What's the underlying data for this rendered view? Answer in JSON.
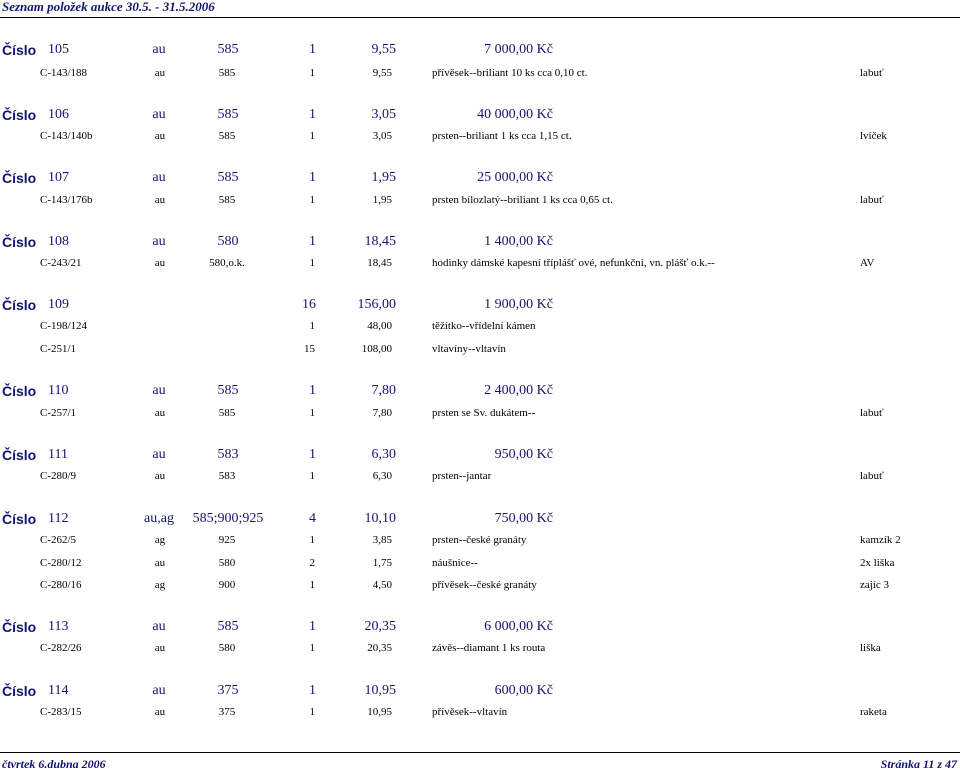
{
  "document": {
    "title": "Seznam položek aukce 30.5. - 31.5.2006",
    "number_label": "Číslo"
  },
  "items": [
    {
      "number": "105",
      "metal": "au",
      "fineness": "585",
      "count": "1",
      "weight": "9,55",
      "price": "7 000,00 Kč",
      "pieces": [
        {
          "code": "C-143/188",
          "metal": "au",
          "fineness": "585",
          "count": "1",
          "weight": "9,55",
          "description": "přívěsek--briliant 10 ks cca 0,10 ct.",
          "mark": "labuť"
        }
      ]
    },
    {
      "number": "106",
      "metal": "au",
      "fineness": "585",
      "count": "1",
      "weight": "3,05",
      "price": "40 000,00 Kč",
      "pieces": [
        {
          "code": "C-143/140b",
          "metal": "au",
          "fineness": "585",
          "count": "1",
          "weight": "3,05",
          "description": "prsten--briliant 1 ks cca 1,15 ct.",
          "mark": "lvíček"
        }
      ]
    },
    {
      "number": "107",
      "metal": "au",
      "fineness": "585",
      "count": "1",
      "weight": "1,95",
      "price": "25 000,00 Kč",
      "pieces": [
        {
          "code": "C-143/176b",
          "metal": "au",
          "fineness": "585",
          "count": "1",
          "weight": "1,95",
          "description": "prsten bílozlatý--briliant 1 ks cca 0,65 ct.",
          "mark": "labuť"
        }
      ]
    },
    {
      "number": "108",
      "metal": "au",
      "fineness": "580",
      "count": "1",
      "weight": "18,45",
      "price": "1 400,00 Kč",
      "pieces": [
        {
          "code": "C-243/21",
          "metal": "au",
          "fineness": "580,o.k.",
          "count": "1",
          "weight": "18,45",
          "description": "hodinky dámské kapesní tříplášť ové, nefunkční, vn. plášť o.k.--",
          "mark": "AV"
        }
      ]
    },
    {
      "number": "109",
      "count": "16",
      "weight": "156,00",
      "price": "1 900,00 Kč",
      "pieces": [
        {
          "code": "C-198/124",
          "count": "1",
          "weight": "48,00",
          "description": "těžítko--vřídelní kámen"
        },
        {
          "code": "C-251/1",
          "count": "15",
          "weight": "108,00",
          "description": "vltavíny--vltavín"
        }
      ]
    },
    {
      "number": "110",
      "metal": "au",
      "fineness": "585",
      "count": "1",
      "weight": "7,80",
      "price": "2 400,00 Kč",
      "pieces": [
        {
          "code": "C-257/1",
          "metal": "au",
          "fineness": "585",
          "count": "1",
          "weight": "7,80",
          "description": "prsten se Sv. dukátem--",
          "mark": "labuť"
        }
      ]
    },
    {
      "number": "111",
      "metal": "au",
      "fineness": "583",
      "count": "1",
      "weight": "6,30",
      "price": "950,00 Kč",
      "pieces": [
        {
          "code": "C-280/9",
          "metal": "au",
          "fineness": "583",
          "count": "1",
          "weight": "6,30",
          "description": "prsten--jantar",
          "mark": "labuť"
        }
      ]
    },
    {
      "number": "112",
      "metal": "au,ag",
      "fineness": "585;900;925",
      "count": "4",
      "weight": "10,10",
      "price": "750,00 Kč",
      "pieces": [
        {
          "code": "C-262/5",
          "metal": "ag",
          "fineness": "925",
          "count": "1",
          "weight": "3,85",
          "description": "prsten--české granáty",
          "mark": "kamzík 2"
        },
        {
          "code": "C-280/12",
          "metal": "au",
          "fineness": "580",
          "count": "2",
          "weight": "1,75",
          "description": "náušnice--",
          "mark": "2x liška"
        },
        {
          "code": "C-280/16",
          "metal": "ag",
          "fineness": "900",
          "count": "1",
          "weight": "4,50",
          "description": "přívěsek--české granáty",
          "mark": "zajíc 3"
        }
      ]
    },
    {
      "number": "113",
      "metal": "au",
      "fineness": "585",
      "count": "1",
      "weight": "20,35",
      "price": "6 000,00 Kč",
      "pieces": [
        {
          "code": "C-282/26",
          "metal": "au",
          "fineness": "580",
          "count": "1",
          "weight": "20,35",
          "description": "závěs--diamant 1 ks routa",
          "mark": "liška"
        }
      ]
    },
    {
      "number": "114",
      "metal": "au",
      "fineness": "375",
      "count": "1",
      "weight": "10,95",
      "price": "600,00 Kč",
      "pieces": [
        {
          "code": "C-283/15",
          "metal": "au",
          "fineness": "375",
          "count": "1",
          "weight": "10,95",
          "description": "přívěsek--vltavín",
          "mark": "raketa"
        }
      ]
    }
  ],
  "footer": {
    "date": "čtvrtek 6.dubna 2006",
    "page": "Stránka 11 z 47"
  },
  "colors": {
    "heading": "#141470",
    "text": "#000000"
  }
}
